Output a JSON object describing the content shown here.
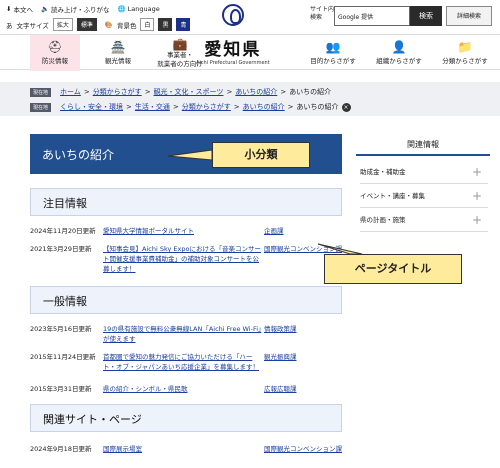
{
  "util": {
    "text_version": "本文へ",
    "read_aloud": "読み上げ・ふりがな",
    "language": "Language",
    "font_size_label": "文字サイズ",
    "font_large": "拡大",
    "font_standard": "標準",
    "bg_color_label": "背景色",
    "bg_white": "白",
    "bg_black": "黒",
    "bg_blue": "青"
  },
  "brand": {
    "jp": "愛知県",
    "en": "Aichi Prefectural Government"
  },
  "search": {
    "label_line1": "サイト内",
    "label_line2": "検索",
    "placeholder": "Google 提供",
    "button": "検索",
    "advanced": "詳細検索"
  },
  "nav": {
    "disaster": "防災情報",
    "tourism": "観光情報",
    "business_line1": "事業者・",
    "business_line2": "就業者の方向け",
    "purpose": "目的からさがす",
    "org": "組織からさがす",
    "category": "分類からさがす"
  },
  "breadcrumbs": [
    {
      "tag": "現在地",
      "items": [
        "ホーム",
        "分類からさがす",
        "観光・文化・スポーツ",
        "あいちの紹介"
      ],
      "current": "あいちの紹介"
    },
    {
      "tag": "現在地",
      "items": [
        "くらし・安全・環境",
        "生活・交通",
        "分類からさがす",
        "あいちの紹介"
      ],
      "current": "あいちの紹介"
    }
  ],
  "page_title": "あいちの紹介",
  "sections": {
    "featured": "注目情報",
    "general": "一般情報",
    "related": "関連サイト・ページ"
  },
  "featured_rows": [
    {
      "date": "2024年11月20日更新",
      "text": "愛知県大学情報ポータルサイト",
      "dept": "企画課"
    },
    {
      "date": "2021年3月29日更新",
      "text": "【知事会見】Aichi Sky Expoにおける「音楽コンサート開催支援事業費補助金」の補助対象コンサートを公募します！",
      "dept": "国際観光コンベンション課"
    }
  ],
  "general_rows": [
    {
      "date": "2023年5月16日更新",
      "text": "19の県有施設で無料公衆無線LAN「Aichi Free Wi-Fi」が使えます",
      "dept": "情報政策課"
    },
    {
      "date": "2015年11月24日更新",
      "text": "首都圏で愛知の魅力発信にご協力いただける「ハート・オブ・ジャパンあいち応援企業」を募集します！",
      "dept": "観光振興課"
    },
    {
      "date": "2015年3月31日更新",
      "text": "県の紹介・シンボル・県民歌",
      "dept": "広報広聴課"
    }
  ],
  "related_rows": [
    {
      "date": "2024年9月18日更新",
      "text": "国際展示場室",
      "dept": "国際観光コンベンション課"
    }
  ],
  "side": {
    "title": "関連情報",
    "items": [
      "助成金・補助金",
      "イベント・講座・募集",
      "県の計画・施策"
    ]
  },
  "annotations": {
    "small_category": "小分類",
    "page_title": "ページタイトル"
  }
}
